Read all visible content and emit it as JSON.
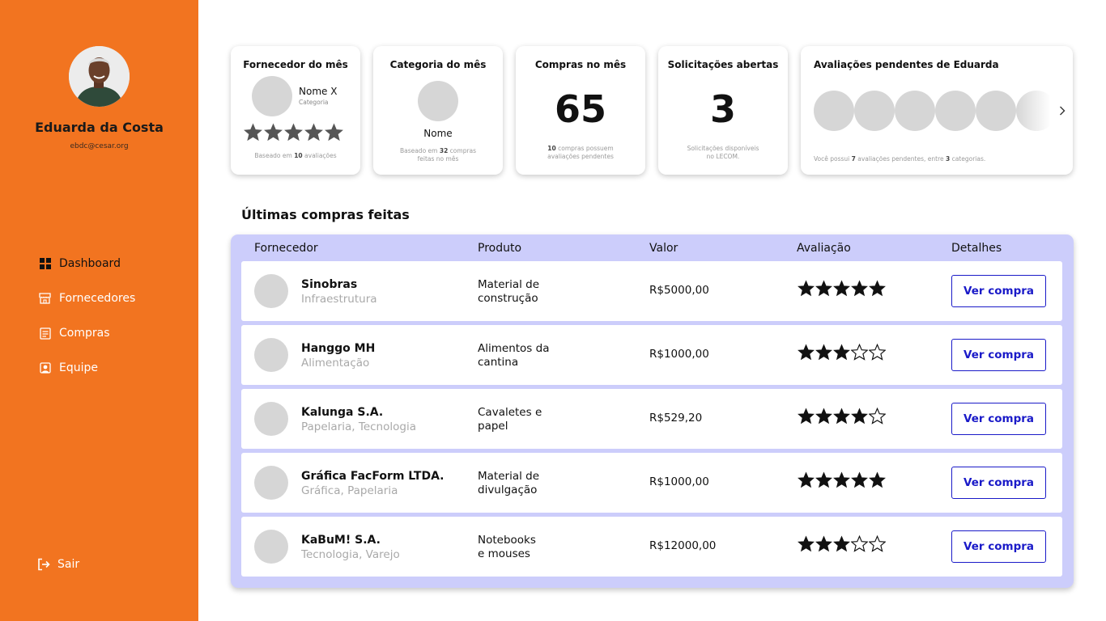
{
  "user": {
    "name": "Eduarda da Costa",
    "email": "ebdc@cesar.org"
  },
  "nav": [
    {
      "label": "Dashboard",
      "icon": "dashboard-grid-icon",
      "active": true
    },
    {
      "label": "Fornecedores",
      "icon": "store-icon",
      "active": false
    },
    {
      "label": "Compras",
      "icon": "receipt-icon",
      "active": false
    },
    {
      "label": "Equipe",
      "icon": "user-square-icon",
      "active": false
    }
  ],
  "logout_label": "Sair",
  "cards": {
    "supplier": {
      "title": "Fornecedor do mês",
      "name": "Nome X",
      "category": "Categoria",
      "stars": 5,
      "note_prefix": "Baseado em ",
      "note_count": "10",
      "note_suffix": " avaliações"
    },
    "category": {
      "title": "Categoria do mês",
      "name": "Nome",
      "note_prefix": "Baseado em ",
      "note_count": "32",
      "note_suffix": " compras",
      "note_line2": "feitas no mês"
    },
    "purchases": {
      "title": "Compras no mês",
      "value": "65",
      "note_count": "10",
      "note_line1": " compras possuem",
      "note_line2": "avaliações pendentes"
    },
    "requests": {
      "title": "Solicitações abertas",
      "value": "3",
      "note_line1": "Solicitações disponíveis",
      "note_line2": "no LECOM."
    },
    "reviews": {
      "title": "Avaliações pendentes de Eduarda",
      "note_prefix": "Você possui ",
      "note_count": "7",
      "note_mid": " avaliações pendentes, entre ",
      "note_cats": "3",
      "note_suffix": " categorias."
    }
  },
  "section_title": "Últimas compras feitas",
  "table": {
    "headers": [
      "Fornecedor",
      "Produto",
      "Valor",
      "Avaliação",
      "Detalhes"
    ],
    "button_label": "Ver compra",
    "rows": [
      {
        "supplier": "Sinobras",
        "category": "Infraestrutura",
        "product_l1": "Material de",
        "product_l2": "construção",
        "value": "R$5000,00",
        "rating": 5
      },
      {
        "supplier": "Hanggo MH",
        "category": "Alimentação",
        "product_l1": "Alimentos da",
        "product_l2": "cantina",
        "value": "R$1000,00",
        "rating": 3
      },
      {
        "supplier": "Kalunga S.A.",
        "category": "Papelaria, Tecnologia",
        "product_l1": "Cavaletes e",
        "product_l2": "papel",
        "value": "R$529,20",
        "rating": 4
      },
      {
        "supplier": "Gráfica FacForm LTDA.",
        "category": "Gráfica, Papelaria",
        "product_l1": "Material de",
        "product_l2": "divulgação",
        "value": "R$1000,00",
        "rating": 5
      },
      {
        "supplier": "KaBuM! S.A.",
        "category": "Tecnologia, Varejo",
        "product_l1": "Notebooks",
        "product_l2": "e mouses",
        "value": "R$12000,00",
        "rating": 3
      }
    ]
  },
  "colors": {
    "sidebar": "#f27420",
    "table_panel": "#cccdfb",
    "button_accent": "#1a1ac8"
  }
}
